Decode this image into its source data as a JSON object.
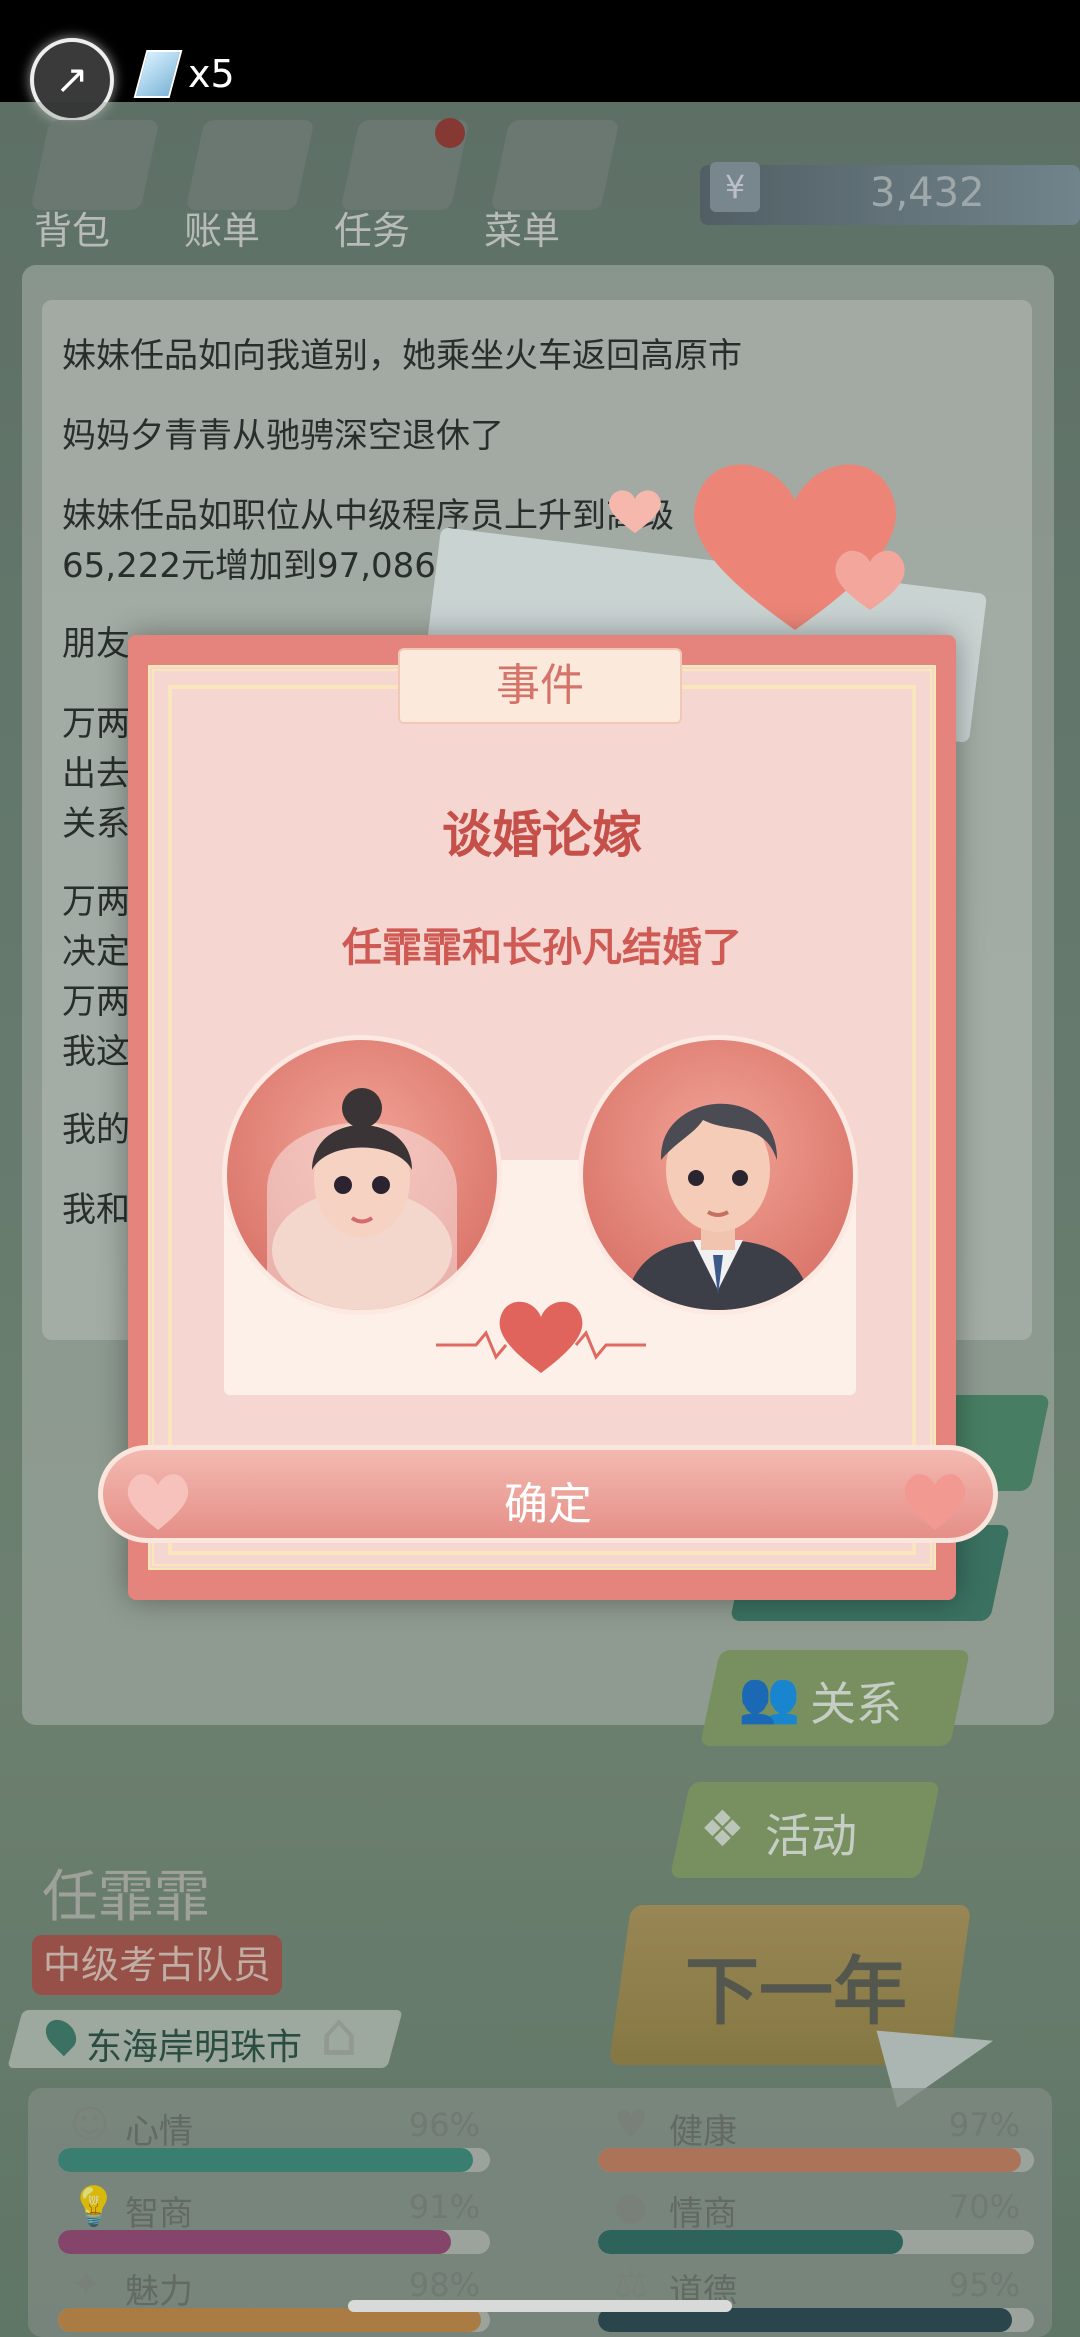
{
  "status": {
    "gem_count": "x5"
  },
  "top_nav": [
    {
      "label": "背包",
      "icon": "backpack-icon"
    },
    {
      "label": "账单",
      "icon": "bill-icon"
    },
    {
      "label": "任务",
      "icon": "task-icon"
    },
    {
      "label": "菜单",
      "icon": "menu-icon"
    }
  ],
  "money": {
    "symbol": "¥",
    "value": "3,432"
  },
  "log": [
    "妹妹任品如向我道别，她乘坐火车返回高原市",
    "妈妈夕青青从驰骋深空退休了",
    "妹妹任品如职位从中级程序员上升到高级",
    "65,222元增加到97,086元",
    "朋友",
    "万两",
    "出去",
    "关系",
    "万两",
    "决定",
    "万两",
    "我这",
    "我的",
    "我和"
  ],
  "side_buttons": {
    "relation": "关系",
    "activity": "活动",
    "next_year": "下一年"
  },
  "character": {
    "name": "任霏霏",
    "job": "中级考古队员",
    "location": "东海岸明珠市"
  },
  "stats": [
    {
      "label": "心情",
      "value": "96%",
      "pct": 96,
      "icon": "smile-icon",
      "color": "#3f8f80"
    },
    {
      "label": "健康",
      "value": "97%",
      "pct": 97,
      "icon": "heart-icon",
      "color": "#c98363"
    },
    {
      "label": "智商",
      "value": "91%",
      "pct": 91,
      "icon": "bulb-icon",
      "color": "#9a4a78"
    },
    {
      "label": "情商",
      "value": "70%",
      "pct": 70,
      "icon": "apple-icon",
      "color": "#2f6e66"
    },
    {
      "label": "魅力",
      "value": "98%",
      "pct": 98,
      "icon": "star-icon",
      "color": "#c98c4a"
    },
    {
      "label": "道德",
      "value": "95%",
      "pct": 95,
      "icon": "scale-icon",
      "color": "#2c4a55"
    }
  ],
  "modal": {
    "tab_title": "事件",
    "title": "谈婚论嫁",
    "description": "任霏霏和长孙凡结婚了",
    "confirm_label": "确定"
  }
}
